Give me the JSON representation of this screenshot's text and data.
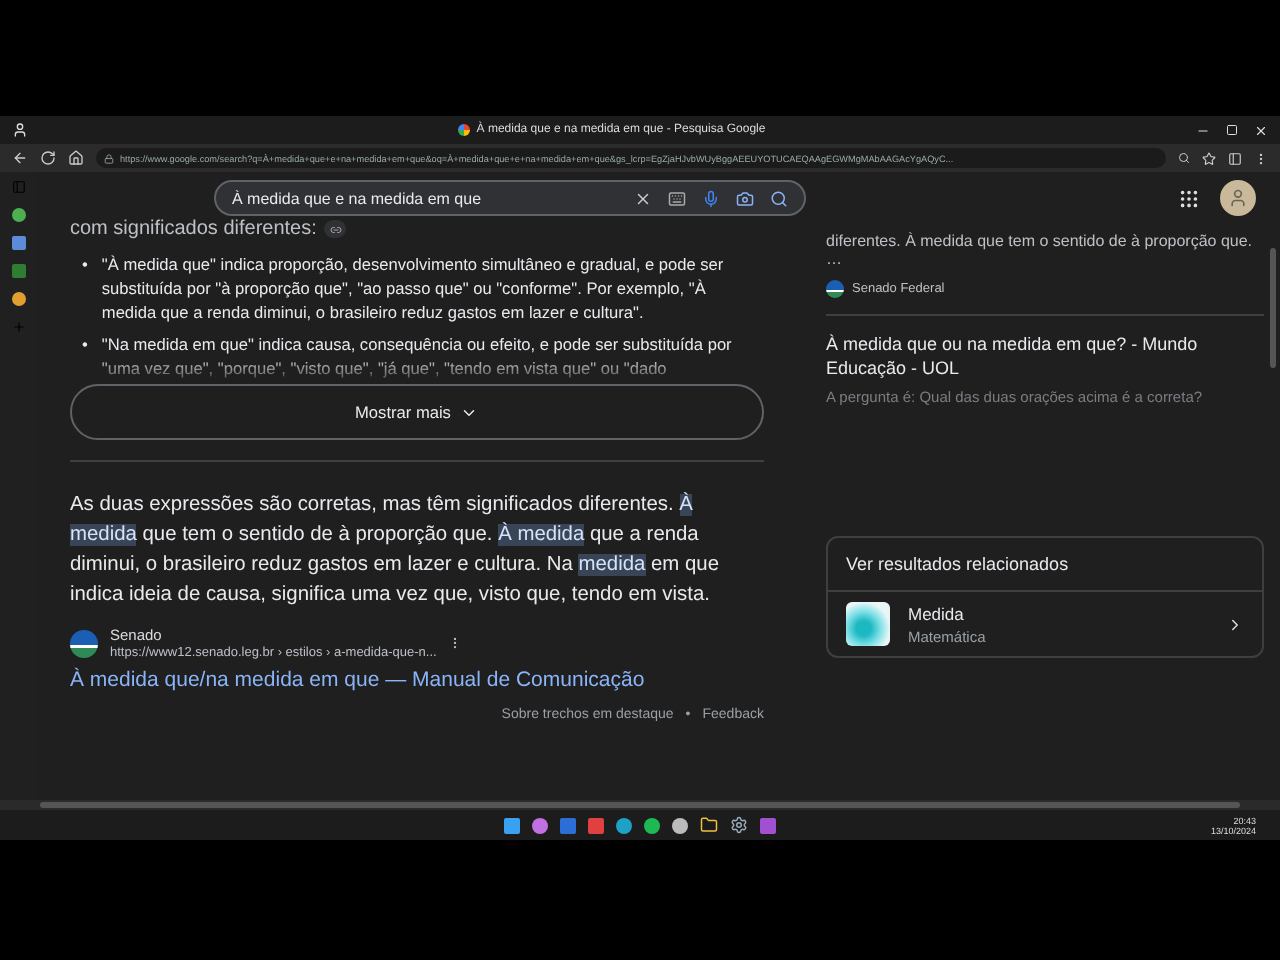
{
  "window": {
    "title": "À medida que e na medida em que - Pesquisa Google"
  },
  "address_bar": {
    "url": "https://www.google.com/search?q=À+medida+que+e+na+medida+em+que&oq=À+medida+que+e+na+medida+em+que&gs_lcrp=EgZjaHJvbWUyBggAEEUYOTUCAEQAAgEGWMgMAbAAGAcYgAQyC..."
  },
  "search": {
    "value": "À medida que e na medida em que"
  },
  "featured": {
    "intro": "com significados diferentes:",
    "bullets": [
      {
        "marker": "•",
        "text": "\"À medida que\" indica proporção, desenvolvimento simultâneo e gradual, e pode ser substituída por \"à proporção que\", \"ao passo que\" ou \"conforme\". Por exemplo, \"À medida que a renda diminui, o brasileiro reduz gastos em lazer e cultura\".",
        "faded": false
      },
      {
        "marker": "•",
        "text": "\"Na medida em que\" indica causa, consequência ou efeito, e pode ser substituída por \"uma vez que\", \"porque\", \"visto que\", \"já que\", \"tendo em vista que\" ou \"dado",
        "faded": true
      }
    ],
    "more_button": "Mostrar mais"
  },
  "answer": {
    "segments": [
      {
        "text": "As duas expressões são corretas, mas têm significados diferentes. ",
        "highlighted": false
      },
      {
        "text": "À medida",
        "highlighted": true
      },
      {
        "text": " que tem o sentido de à proporção que. ",
        "highlighted": false
      },
      {
        "text": "À medida",
        "highlighted": true
      },
      {
        "text": " que a renda diminui, o brasileiro reduz gastos em lazer e cultura. Na ",
        "highlighted": false
      },
      {
        "text": "medida",
        "highlighted": true
      },
      {
        "text": " em que indica ideia de causa, significa uma vez que, visto que, tendo em vista.",
        "highlighted": false
      }
    ],
    "source_name": "Senado",
    "source_url": "https://www12.senado.leg.br › estilos › a-medida-que-n...",
    "link": "À medida que/na medida em que — Manual de Comunicação",
    "footer": [
      "Sobre trechos em destaque",
      "•",
      "Feedback"
    ]
  },
  "side_results": [
    {
      "snippet": "diferentes. À medida que tem o sentido de à proporção que. …",
      "source": "Senado Federal"
    },
    {
      "title": "À medida que ou na medida em que? - Mundo Educação - UOL",
      "snippet": "A pergunta é: Qual das duas orações acima é a correta?"
    }
  ],
  "related": {
    "heading": "Ver resultados relacionados",
    "items": [
      {
        "title": "Medida",
        "subtitle": "Matemática"
      }
    ]
  },
  "taskbar": {
    "time": "20:43",
    "date": "13/10/2024"
  }
}
